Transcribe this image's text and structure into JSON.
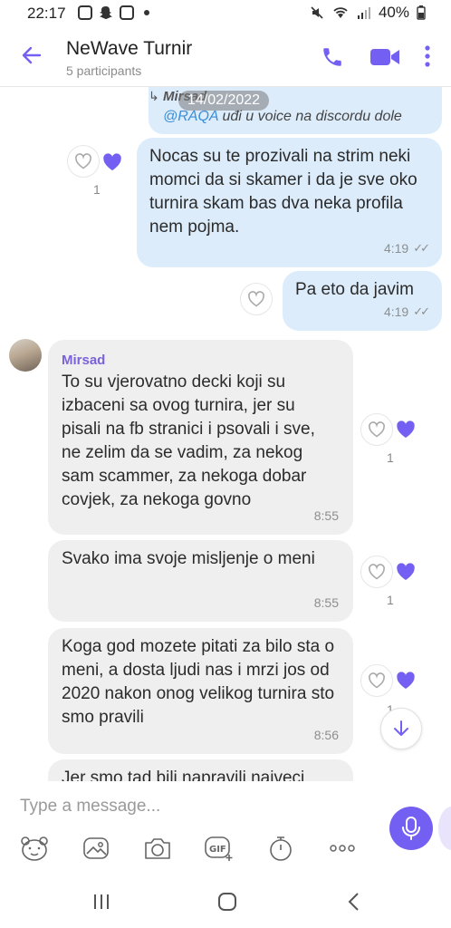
{
  "status": {
    "time": "22:17",
    "battery": "40%"
  },
  "header": {
    "title": "NeWave Turnir",
    "subtitle": "5 participants"
  },
  "chat": {
    "date_pill": "14/02/2022",
    "quote": {
      "sender": "Mirsad",
      "mention": "@RAQA",
      "text": " uđi u voice na discordu dole"
    },
    "messages": [
      {
        "text": "Nocas su te prozivali na strim neki momci da si skamer i da je sve oko turnira skam bas dva neka profila nem pojma.",
        "time": "4:19",
        "likes": "1"
      },
      {
        "text": "Pa eto da javim",
        "time": "4:19"
      },
      {
        "sender": "Mirsad",
        "text": "To su vjerovatno decki koji su izbaceni sa ovog turnira, jer su pisali na fb stranici i psovali i sve, ne zelim da se vadim, za nekog sam scammer, za nekoga dobar covjek, za nekoga govno",
        "time": "8:55",
        "likes": "1"
      },
      {
        "text": "Svako ima svoje misljenje o meni",
        "time": "8:55",
        "likes": "1"
      },
      {
        "text": "Koga god mozete pitati za bilo sta o meni, a dosta ljudi nas i mrzi jos od 2020 nakon onog velikog turnira sto smo pravili",
        "time": "8:56",
        "likes": "1"
      },
      {
        "text": "Jer smo tad bili napravili najveci"
      }
    ]
  },
  "composer": {
    "placeholder": "Type a message..."
  },
  "icons": {
    "back": "back-arrow-icon",
    "call": "phone-icon",
    "video": "video-camera-icon",
    "more": "more-vertical-icon",
    "like": "heart-icon",
    "scroll": "arrow-down-icon",
    "mic": "microphone-icon"
  },
  "colors": {
    "accent": "#7360f2",
    "outgoing_bubble": "#dcecfb",
    "incoming_bubble": "#efefef",
    "mention": "#3b8ed6"
  }
}
